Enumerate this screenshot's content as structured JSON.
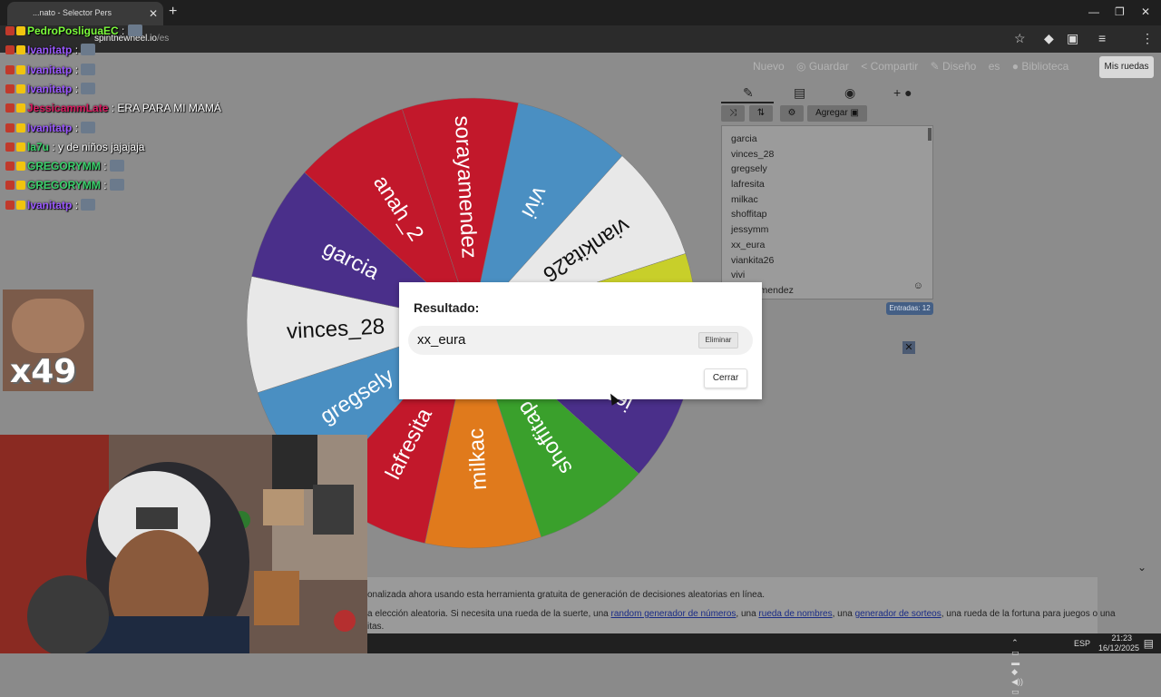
{
  "browser": {
    "tab_title": "Ruleta de nombres Gratis - Selector Personalizado",
    "tab_title_visible": "...nato - Selector Pers",
    "url_host": "spinthewheel.io",
    "url_path": "/es"
  },
  "nav": {
    "items": [
      "Nuevo",
      "Guardar",
      "Compartir",
      "Diseño",
      "es",
      "Biblioteca"
    ],
    "my_wheels": "Mis ruedas"
  },
  "panel": {
    "add_label": "Agregar",
    "entries": [
      "garcia",
      "vinces_28",
      "gregsely",
      "lafresita",
      "milkac",
      "shoffitap",
      "jessymm",
      "xx_eura",
      "viankita26",
      "vivi",
      "sorayamendez"
    ],
    "count_label": "Entradas: 12"
  },
  "wheel": {
    "segments": [
      {
        "label": "vivi",
        "color": "#4a8fc2"
      },
      {
        "label": "viankita26",
        "color": "#e8e8e8"
      },
      {
        "label": "xx_eura",
        "color": "#c8cf2a"
      },
      {
        "label": "jessymm",
        "color": "#4a2f8a"
      },
      {
        "label": "shoffitap",
        "color": "#3aa02c"
      },
      {
        "label": "milkac",
        "color": "#e07a1c"
      },
      {
        "label": "lafresita",
        "color": "#c2182b"
      },
      {
        "label": "gregsely",
        "color": "#4a8fc2"
      },
      {
        "label": "vinces_28",
        "color": "#e8e8e8"
      },
      {
        "label": "garcia",
        "color": "#4a2f8a"
      },
      {
        "label": "anah_2",
        "color": "#c2182b"
      },
      {
        "label": "sorayamendez",
        "color": "#c2182b"
      }
    ]
  },
  "dialog": {
    "title": "Resultado:",
    "result": "xx_eura",
    "delete_label": "Eliminar",
    "close_label": "Cerrar"
  },
  "footer": {
    "line1": "onalizada ahora usando esta herramienta gratuita de generación de decisiones aleatorias en línea.",
    "line2_a": "a elección aleatoria. Si necesita una rueda de la suerte, una ",
    "link1": "random generador de números",
    "line2_b": ", una ",
    "link2": "rueda de nombres",
    "line2_c": ", una ",
    "link3": "generador de sorteos",
    "line2_d": ", una rueda de la fortuna para juegos o una",
    "line3": "itas."
  },
  "taskbar": {
    "lang": "ESP",
    "time": "21:23",
    "date": "16/12/2025"
  },
  "chat": {
    "messages": [
      {
        "user": "PedroPosliguaEC",
        "color": "#7cfc3c",
        "text": ":"
      },
      {
        "user": "Ivanitatp",
        "color": "#9b59ff",
        "text": ":"
      },
      {
        "user": "Ivanitatp",
        "color": "#9b59ff",
        "text": ":"
      },
      {
        "user": "Ivanitatp",
        "color": "#9b59ff",
        "text": ":"
      },
      {
        "user": "JessicammLate",
        "color": "#d81b60",
        "text": ": ERA PARA MI MAMÁ"
      },
      {
        "user": "Ivanitatp",
        "color": "#9b59ff",
        "text": ":"
      },
      {
        "user": "la7u",
        "color": "#3ad16b",
        "text": ": y de niños jajajaja"
      },
      {
        "user": "GREGORYMM",
        "color": "#3ad16b",
        "text": ":"
      },
      {
        "user": "GREGORYMM",
        "color": "#3ad16b",
        "text": ":"
      },
      {
        "user": "Ivanitatp",
        "color": "#9b59ff",
        "text": ":"
      }
    ],
    "combo": "x49"
  }
}
